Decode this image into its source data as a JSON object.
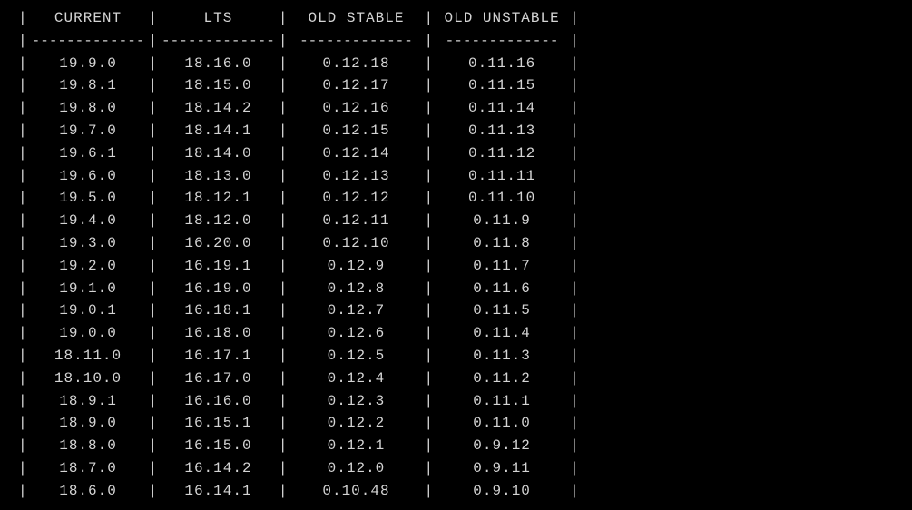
{
  "columns": [
    {
      "header": "CURRENT",
      "divider": "-------------"
    },
    {
      "header": "LTS",
      "divider": "-------------"
    },
    {
      "header": "OLD STABLE",
      "divider": "-------------"
    },
    {
      "header": "OLD UNSTABLE",
      "divider": "-------------"
    }
  ],
  "chart_data": {
    "type": "table",
    "title": "",
    "columns": [
      "CURRENT",
      "LTS",
      "OLD STABLE",
      "OLD UNSTABLE"
    ],
    "rows": [
      [
        "19.9.0",
        "18.16.0",
        "0.12.18",
        "0.11.16"
      ],
      [
        "19.8.1",
        "18.15.0",
        "0.12.17",
        "0.11.15"
      ],
      [
        "19.8.0",
        "18.14.2",
        "0.12.16",
        "0.11.14"
      ],
      [
        "19.7.0",
        "18.14.1",
        "0.12.15",
        "0.11.13"
      ],
      [
        "19.6.1",
        "18.14.0",
        "0.12.14",
        "0.11.12"
      ],
      [
        "19.6.0",
        "18.13.0",
        "0.12.13",
        "0.11.11"
      ],
      [
        "19.5.0",
        "18.12.1",
        "0.12.12",
        "0.11.10"
      ],
      [
        "19.4.0",
        "18.12.0",
        "0.12.11",
        "0.11.9"
      ],
      [
        "19.3.0",
        "16.20.0",
        "0.12.10",
        "0.11.8"
      ],
      [
        "19.2.0",
        "16.19.1",
        "0.12.9",
        "0.11.7"
      ],
      [
        "19.1.0",
        "16.19.0",
        "0.12.8",
        "0.11.6"
      ],
      [
        "19.0.1",
        "16.18.1",
        "0.12.7",
        "0.11.5"
      ],
      [
        "19.0.0",
        "16.18.0",
        "0.12.6",
        "0.11.4"
      ],
      [
        "18.11.0",
        "16.17.1",
        "0.12.5",
        "0.11.3"
      ],
      [
        "18.10.0",
        "16.17.0",
        "0.12.4",
        "0.11.2"
      ],
      [
        "18.9.1",
        "16.16.0",
        "0.12.3",
        "0.11.1"
      ],
      [
        "18.9.0",
        "16.15.1",
        "0.12.2",
        "0.11.0"
      ],
      [
        "18.8.0",
        "16.15.0",
        "0.12.1",
        "0.9.12"
      ],
      [
        "18.7.0",
        "16.14.2",
        "0.12.0",
        "0.9.11"
      ],
      [
        "18.6.0",
        "16.14.1",
        "0.10.48",
        "0.9.10"
      ]
    ]
  },
  "pipe": "|"
}
